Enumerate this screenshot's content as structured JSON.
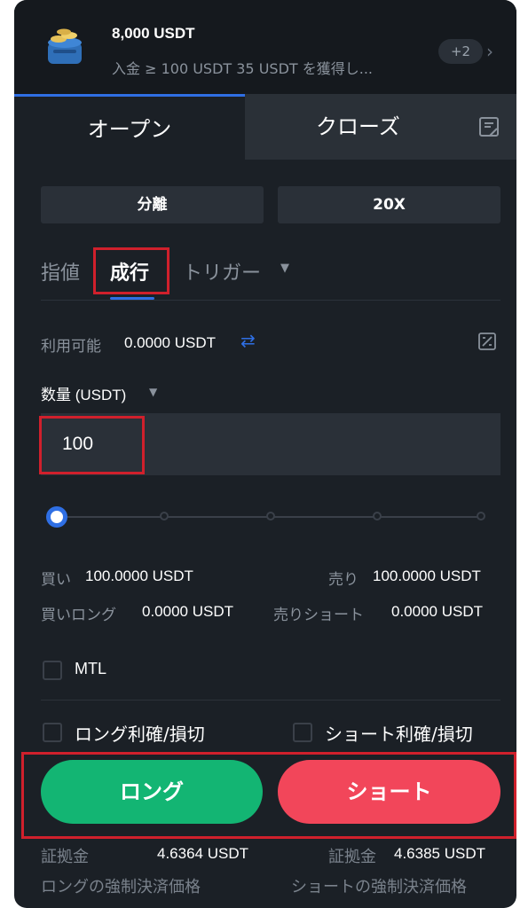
{
  "promo": {
    "amount": "8,000 USDT",
    "description": "入金 ≥ 100 USDT 35 USDT を獲得し...",
    "badge": "+2",
    "chevron": "›",
    "icon": "coin-stack-icon"
  },
  "tabs": {
    "open": "オープン",
    "close": "クローズ",
    "icon": "document-icon"
  },
  "margin_mode": {
    "mode": "分離",
    "leverage": "20X"
  },
  "order_types": {
    "limit": "指値",
    "market": "成行",
    "trigger": "トリガー",
    "trigger_caret": "▼"
  },
  "available": {
    "label": "利用可能",
    "value": "0.0000 USDT",
    "transfer_icon": "⇄"
  },
  "quantity": {
    "label": "数量 (USDT)",
    "caret": "▼",
    "value": "100"
  },
  "slider": {
    "value_percent": 0
  },
  "trade_info": {
    "buy_label": "買い",
    "buy_value": "100.0000 USDT",
    "sell_label": "売り",
    "sell_value": "100.0000 USDT",
    "buy_long_label": "買いロング",
    "buy_long_value": "0.0000 USDT",
    "sell_short_label": "売りショート",
    "sell_short_value": "0.0000 USDT"
  },
  "options": {
    "mtl": "MTL",
    "long_tpsl": "ロング利確/損切",
    "short_tpsl": "ショート利確/損切"
  },
  "actions": {
    "long": "ロング",
    "short": "ショート"
  },
  "footer": {
    "margin_label": "証拠金",
    "long_margin": "4.6364 USDT",
    "short_margin_label": "証拠金",
    "short_margin": "4.6385 USDT",
    "long_liq_label": "ロングの強制決済価格",
    "short_liq_label": "ショートの強制決済価格"
  },
  "colors": {
    "accent": "#2f6fe4",
    "long": "#13b573",
    "short": "#f2465a",
    "highlight": "#d0202c"
  }
}
